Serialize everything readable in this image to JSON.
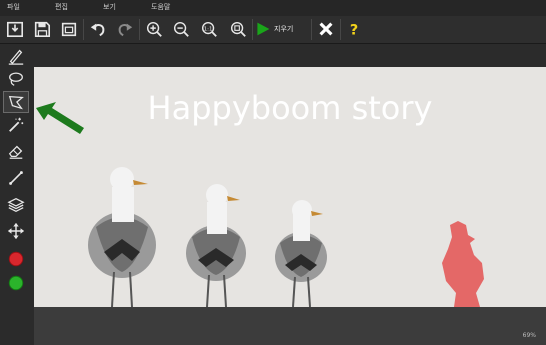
{
  "menu": {
    "file": "파일",
    "edit": "편집",
    "view": "보기",
    "help": "도움말"
  },
  "toolbar": {
    "erase_label": "지우기",
    "icons": [
      "import-icon",
      "save-icon",
      "window-icon",
      "undo-icon",
      "redo-icon",
      "zoom-in-icon",
      "zoom-out-icon",
      "zoom-actual-icon",
      "zoom-fit-icon",
      "play-icon",
      "close-icon",
      "help-icon"
    ]
  },
  "sidebar": {
    "tools": [
      "brush-icon",
      "lasso-icon",
      "polygon-lasso-icon",
      "magic-wand-icon",
      "eraser-icon",
      "line-icon",
      "layers-icon",
      "move-icon"
    ],
    "color_fg": "#d9272d",
    "color_bg": "#2bb32b"
  },
  "image": {
    "title": "Happyboom story"
  },
  "status": {
    "zoom": "69%"
  },
  "colors": {
    "accent_green": "#1aa51a",
    "selection_red": "#e34848"
  }
}
